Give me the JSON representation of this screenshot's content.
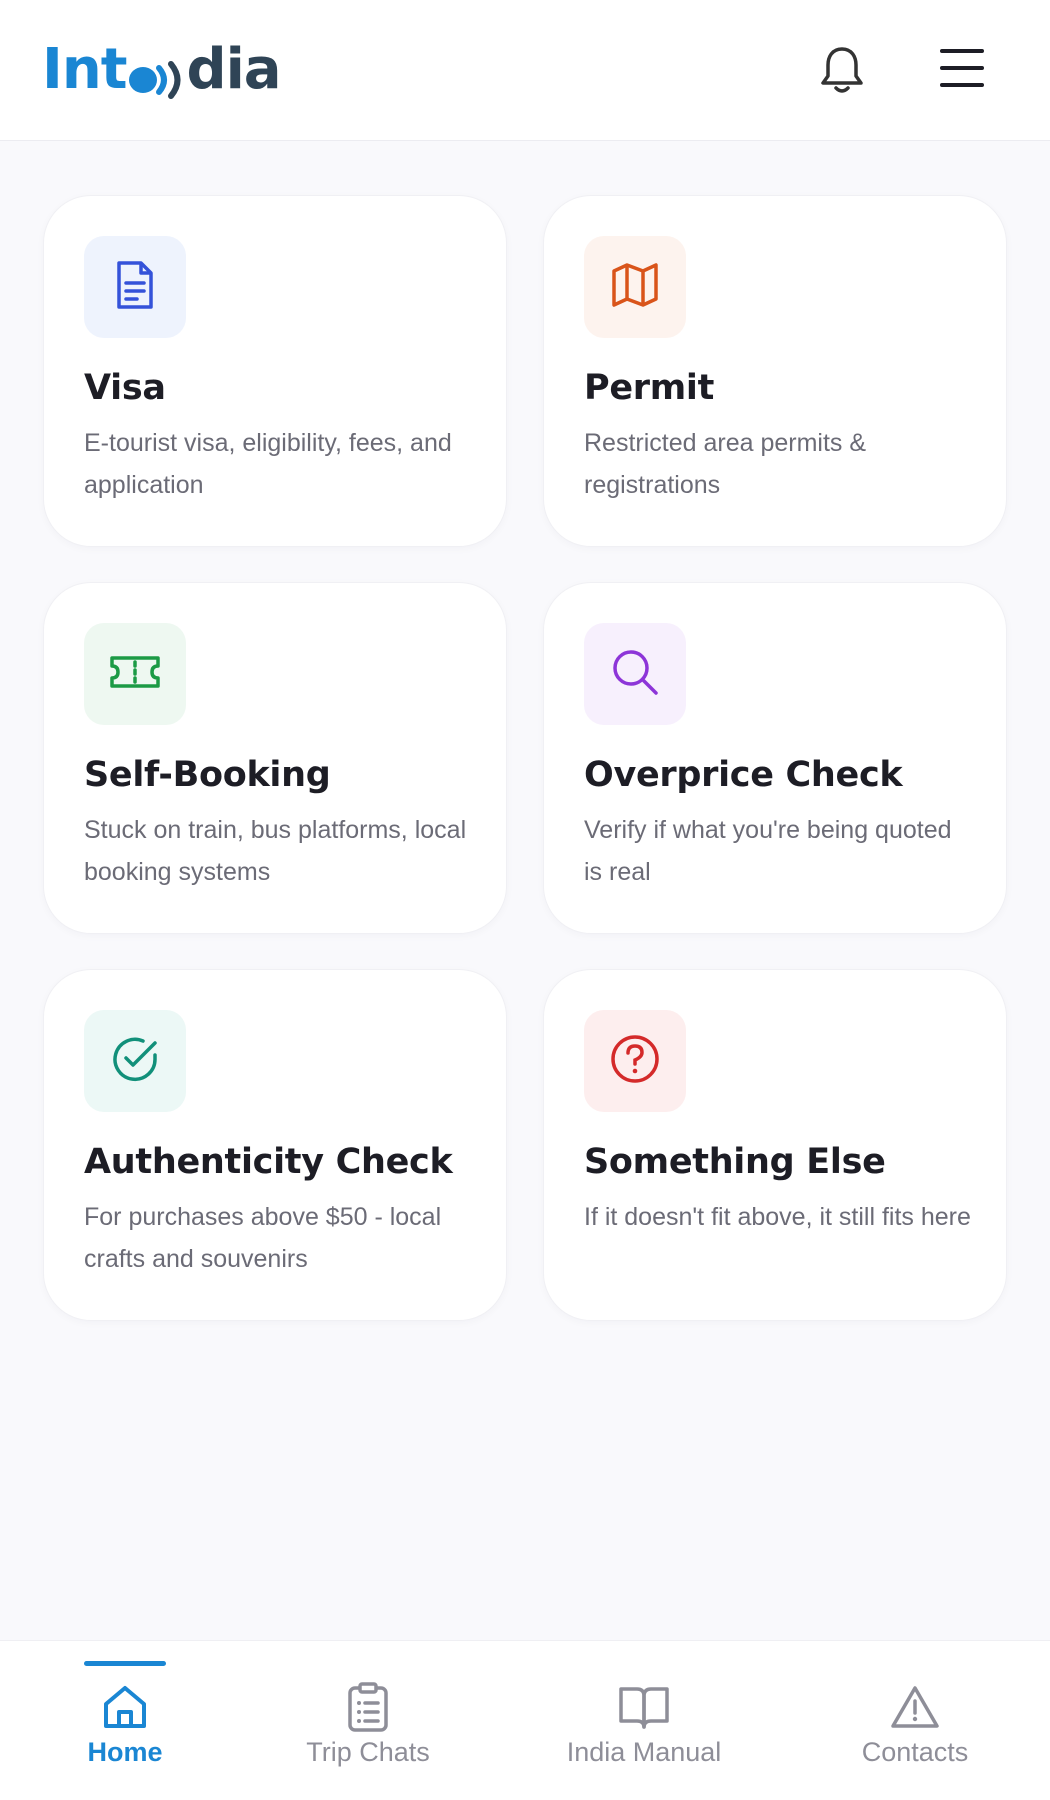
{
  "header": {
    "logo_left": "Int",
    "logo_right": "dia",
    "brand_color": "#1a86d3",
    "brand_dark": "#2f4456",
    "notification_icon": "bell-icon",
    "menu_icon": "hamburger-menu-icon"
  },
  "cards": [
    {
      "title": "Visa",
      "description": "E-tourist visa, eligibility, fees, and application",
      "icon": "document-icon",
      "accent": "#3452d9",
      "icon_bg": "#eef3fd"
    },
    {
      "title": "Permit",
      "description": "Restricted area permits & registrations",
      "icon": "map-icon",
      "accent": "#d9541a",
      "icon_bg": "#fdf3ee"
    },
    {
      "title": "Self-Booking",
      "description": "Stuck on train, bus platforms, local booking systems",
      "icon": "ticket-icon",
      "accent": "#1b9a45",
      "icon_bg": "#eef8f1"
    },
    {
      "title": "Overprice Check",
      "description": "Verify if what you're being quoted is real",
      "icon": "search-icon",
      "accent": "#8d35d8",
      "icon_bg": "#f7f0fd"
    },
    {
      "title": "Authenticity Check",
      "description": "For purchases above $50 - local crafts and souvenirs",
      "icon": "check-circle-icon",
      "accent": "#11907a",
      "icon_bg": "#ecf8f6"
    },
    {
      "title": "Something Else",
      "description": "If it doesn't fit above, it still fits here",
      "icon": "question-circle-icon",
      "accent": "#d42a2a",
      "icon_bg": "#fdeeee"
    }
  ],
  "tabs": [
    {
      "label": "Home",
      "icon": "home-icon",
      "active": true
    },
    {
      "label": "Trip Chats",
      "icon": "clipboard-list-icon",
      "active": false
    },
    {
      "label": "India Manual",
      "icon": "book-icon",
      "active": false
    },
    {
      "label": "Contacts",
      "icon": "warning-icon",
      "active": false
    }
  ]
}
